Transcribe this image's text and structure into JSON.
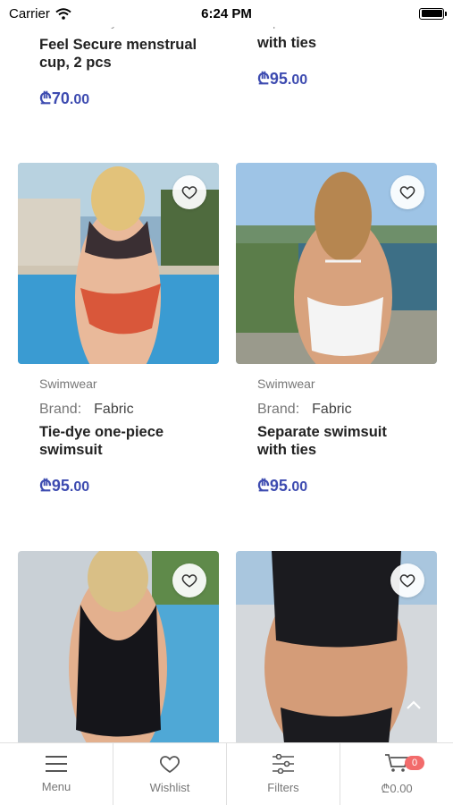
{
  "status_bar": {
    "carrier": "Carrier",
    "time": "6:24 PM"
  },
  "top_row": [
    {
      "fragment": "Brand:    Satisfyer",
      "title": "Feel Secure menstrual cup, 2 pcs",
      "price_main": "₾70",
      "price_cents": ".00"
    },
    {
      "fragment": "Separate swimsuit",
      "title": "with ties",
      "price_main": "₾95",
      "price_cents": ".00"
    }
  ],
  "products": [
    {
      "category": "Swimwear",
      "brand_label": "Brand:",
      "brand": "Fabric",
      "title": "Tie-dye one-piece swimsuit",
      "price_main": "₾95",
      "price_cents": ".00"
    },
    {
      "category": "Swimwear",
      "brand_label": "Brand:",
      "brand": "Fabric",
      "title": "Separate swimsuit with ties",
      "price_main": "₾95",
      "price_cents": ".00"
    }
  ],
  "tab_bar": {
    "menu": "Menu",
    "wishlist": "Wishlist",
    "filters": "Filters",
    "cart_total": "₾0.00",
    "cart_count": "0"
  },
  "colors": {
    "price": "#3d4bb0",
    "badge": "#f26b6b"
  }
}
